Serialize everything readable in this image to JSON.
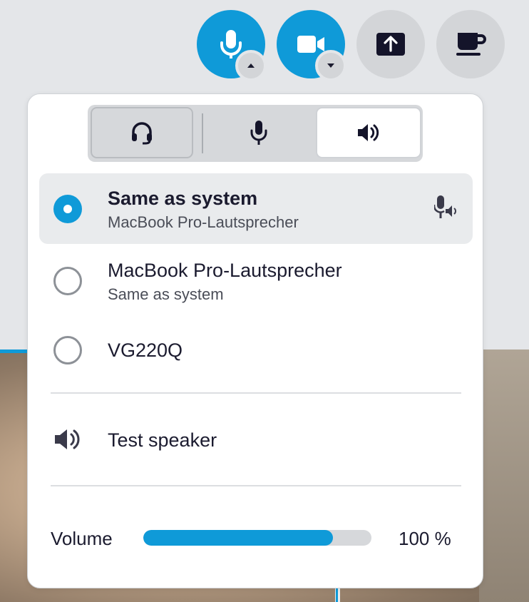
{
  "colors": {
    "accent": "#0f9ad8",
    "text": "#1b1b2f",
    "muted": "#4a4d57"
  },
  "toolbar": {
    "mic_icon": "microphone-icon",
    "camera_icon": "video-camera-icon",
    "share_icon": "share-screen-icon",
    "break_icon": "coffee-cup-icon"
  },
  "tabs": [
    {
      "icon": "headset-icon"
    },
    {
      "icon": "microphone-icon"
    },
    {
      "icon": "speaker-icon"
    }
  ],
  "devices": [
    {
      "title": "Same as system",
      "subtitle": "MacBook Pro-Lautsprecher"
    },
    {
      "title": "MacBook Pro-Lautsprecher",
      "subtitle": "Same as system"
    },
    {
      "title": "VG220Q"
    }
  ],
  "test_speaker": {
    "label": "Test speaker"
  },
  "volume": {
    "label": "Volume",
    "value_text": "100 %",
    "fill_fraction": 0.83
  }
}
